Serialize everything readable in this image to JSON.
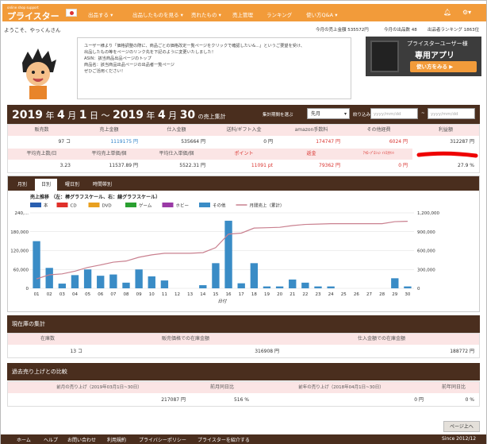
{
  "nav": {
    "logo": "プライスター",
    "logo_sub": "online shop support",
    "menus": [
      "出品する ▾",
      "出品したものを見る ▾",
      "売れたもの ▾",
      "売上管理",
      "ランキング",
      "使い方Q&A ▾"
    ]
  },
  "user": {
    "greeting": "ようこそ、やっくんさん",
    "today_sales": "今月の売上金額 535572円",
    "today_count": "今月の出品数 48",
    "ranking": "出品者ランキング 1863位"
  },
  "notice": {
    "lines": [
      "ユーザー様より「価格調整の際に、商品ごとの価格改定一覧ページをクリックで確認したい&...」というご要望を受け、",
      "出品したもの等をページのリンク先を下記のように変更いたしました！",
      "",
      "ASIN：該当商品出品ページのトップ",
      "商品名：該当商品出品ページの出品者一覧ページ",
      "",
      "ぜひご活用ください！"
    ]
  },
  "app": {
    "line1": "プライスターユーザー様",
    "line2": "専用アプリ",
    "button": "使い方をみる ▶"
  },
  "summary": {
    "year1": "2019",
    "m1": "4",
    "d1": "1",
    "year2": "2019",
    "m2": "4",
    "d2": "30",
    "suffix": "の売上集計",
    "range_label": "集計期間を選ぶ",
    "range_value": "先月",
    "filter_label": "絞り込み",
    "from_ph": "yyyy/mm/dd",
    "to_ph": "yyyy/mm/dd"
  },
  "row1": {
    "labels": [
      "販売数",
      "売上金額",
      "仕入金額",
      "送料/ギフト入金",
      "amazon手数料",
      "その他経費",
      "利益額"
    ],
    "values": [
      "97 コ",
      "1119175 円",
      "535664 円",
      "0 円",
      "174747 円",
      "6024 円",
      "312287 円"
    ]
  },
  "row2": {
    "labels": [
      "平均売上数/日",
      "平均売上単価/個",
      "平均仕入単価/個",
      "ポイント",
      "返金",
      "ｱﾏﾛｰﾌﾟﾛｼｮﾝ ｲﾒｽｶｳﾝﾄ",
      ""
    ],
    "values": [
      "3.23",
      "11537.89 円",
      "5522.31 円",
      "11091 pt",
      "79362 円",
      "0 円",
      "27.9 %"
    ]
  },
  "tabs": [
    "月別",
    "日別",
    "曜日別",
    "時間帯別"
  ],
  "chart_title": "売上推移 （左：棒グラフスケール、右：線グラフスケール）",
  "legend": [
    "本",
    "CD",
    "DVD",
    "ゲーム",
    "ホビー",
    "その他",
    "月間売上（累計）"
  ],
  "colors": {
    "accent": "#f29b3a",
    "dark": "#4a2e1e",
    "bar": "#3a8cc6",
    "line": "#c9808f",
    "pink": "#fbe5e5",
    "red": "#d9302c"
  },
  "chart_data": {
    "type": "bar",
    "categories": [
      "01",
      "02",
      "03",
      "04",
      "05",
      "06",
      "07",
      "08",
      "09",
      "10",
      "11",
      "12",
      "13",
      "14",
      "15",
      "16",
      "17",
      "18",
      "19",
      "20",
      "21",
      "22",
      "23",
      "24",
      "25",
      "26",
      "27",
      "28",
      "29",
      "30"
    ],
    "series": [
      {
        "name": "その他",
        "values": [
          150000,
          65000,
          15000,
          42000,
          60000,
          40000,
          44000,
          18000,
          60000,
          38000,
          25000,
          0,
          0,
          10000,
          80000,
          215000,
          16000,
          80000,
          6000,
          6000,
          28000,
          18000,
          6000,
          6000,
          0,
          0,
          0,
          0,
          32000,
          6000
        ]
      },
      {
        "name": "月間売上（累計）",
        "values": [
          150000,
          215000,
          230000,
          272000,
          332000,
          372000,
          416000,
          434000,
          494000,
          532000,
          557000,
          557000,
          557000,
          567000,
          647000,
          862000,
          878000,
          958000,
          964000,
          970000,
          998000,
          1016000,
          1022000,
          1028000,
          1028000,
          1028000,
          1028000,
          1028000,
          1060000,
          1066000
        ]
      }
    ],
    "ylim": [
      0,
      240000
    ],
    "y2lim": [
      0,
      1200000
    ],
    "yticks": [
      "0",
      "60,000",
      "120,000",
      "180,000",
      "240,..."
    ],
    "y2ticks": [
      "0",
      "300,000",
      "600,000",
      "900,000",
      "1,200,000"
    ],
    "xlabel": "日付"
  },
  "stock": {
    "title": "現在庫の集計",
    "labels": [
      "在庫数",
      "販売価格での在庫金額",
      "仕入金額での在庫金額"
    ],
    "values": [
      "13 コ",
      "316908 円",
      "188772 円"
    ]
  },
  "past": {
    "title": "過去売り上げとの比較",
    "labels": [
      "前月の売り上げ（2019年03月1日~30日）",
      "前月同日比",
      "前年の売り上げ（2018年04月1日~30日）",
      "前年同日比"
    ],
    "values": [
      "217087 円",
      "516 %",
      "0 円",
      "0 %"
    ]
  },
  "footer": {
    "links": [
      "ホーム",
      "ヘルプ",
      "お問い合わせ",
      "利用規約",
      "プライバシーポリシー",
      "プライスターを紹介する"
    ],
    "since": "Since 2012/12",
    "top": "ページ上へ"
  }
}
